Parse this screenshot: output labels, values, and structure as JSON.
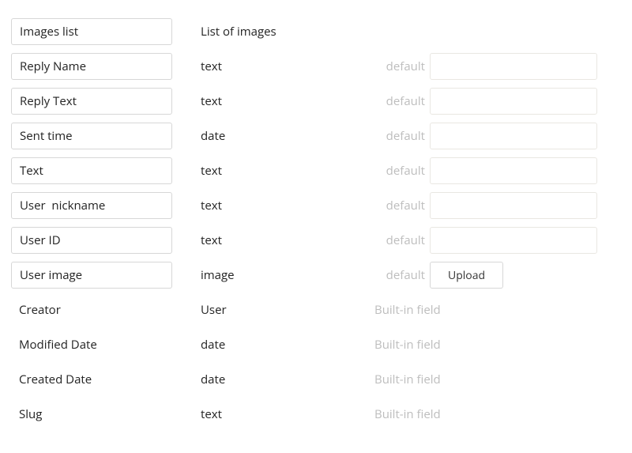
{
  "defaultLabel": "default",
  "builtinLabel": "Built-in field",
  "uploadLabel": "Upload",
  "rows": [
    {
      "name": "Images list",
      "type": "List of images",
      "editable": true,
      "defaultKind": "none"
    },
    {
      "name": "Reply Name",
      "type": "text",
      "editable": true,
      "defaultKind": "input"
    },
    {
      "name": "Reply Text",
      "type": "text",
      "editable": true,
      "defaultKind": "input"
    },
    {
      "name": "Sent time",
      "type": "date",
      "editable": true,
      "defaultKind": "input"
    },
    {
      "name": "Text",
      "type": "text",
      "editable": true,
      "defaultKind": "input"
    },
    {
      "name": "User  nickname",
      "type": "text",
      "editable": true,
      "defaultKind": "input"
    },
    {
      "name": "User ID",
      "type": "text",
      "editable": true,
      "defaultKind": "input"
    },
    {
      "name": "User image",
      "type": "image",
      "editable": true,
      "defaultKind": "upload"
    },
    {
      "name": "Creator",
      "type": "User",
      "editable": false,
      "defaultKind": "builtin"
    },
    {
      "name": "Modified Date",
      "type": "date",
      "editable": false,
      "defaultKind": "builtin"
    },
    {
      "name": "Created Date",
      "type": "date",
      "editable": false,
      "defaultKind": "builtin"
    },
    {
      "name": "Slug",
      "type": "text",
      "editable": false,
      "defaultKind": "builtin"
    }
  ]
}
